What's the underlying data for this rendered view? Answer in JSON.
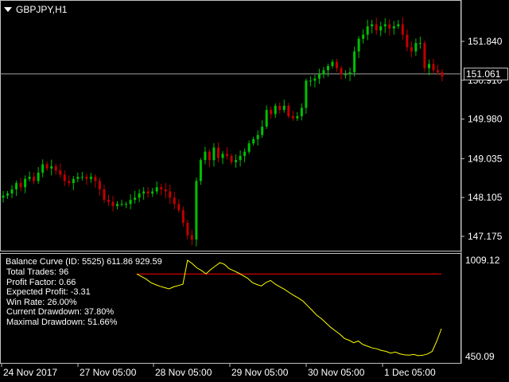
{
  "window": {
    "symbol": "GBPJPY,H1"
  },
  "price_scale": [
    "151.840",
    "150.910",
    "149.980",
    "149.035",
    "148.105",
    "147.175"
  ],
  "current_price": "151.061",
  "indicator": {
    "title": "Balance Curve (ID: 5525) 611.86 929.59",
    "scale": [
      "1009.12",
      "450.09"
    ],
    "stats": [
      "Total Trades: 96",
      "Profit Factor: 0.66",
      "Expected Profit: -3.31",
      "Win Rate: 26.00%",
      "Current Drawdown: 37.80%",
      "Maximal Drawdown: 51.66%"
    ]
  },
  "time_axis": [
    "24 Nov 2017",
    "27 Nov 05:00",
    "28 Nov 05:00",
    "29 Nov 05:00",
    "30 Nov 05:00",
    "1 Dec 05:00"
  ],
  "colors": {
    "background": "#000000",
    "bull_candle": "#00c000",
    "bear_candle": "#c00000",
    "balance_line": "#ffff00",
    "reference_line": "#ff0000",
    "price_line": "#a0a0a0",
    "panel_border": "#c0c0c0"
  },
  "chart_data": [
    {
      "type": "line",
      "title": "",
      "y_ticks": [
        147.175,
        148.105,
        149.035,
        149.98,
        150.91,
        151.84
      ],
      "ylim": [
        146.9,
        152.6
      ],
      "current_price": 151.061,
      "close_series": [
        148.15,
        148.2,
        148.3,
        148.45,
        148.35,
        148.55,
        148.6,
        148.5,
        148.7,
        148.9,
        148.8,
        148.85,
        148.75,
        148.65,
        148.5,
        148.45,
        148.55,
        148.6,
        148.6,
        148.55,
        148.6,
        148.5,
        148.3,
        148.05,
        148.0,
        147.9,
        147.95,
        147.95,
        147.95,
        148.05,
        148.1,
        148.2,
        148.25,
        148.2,
        148.25,
        148.35,
        148.3,
        148.25,
        148.1,
        147.95,
        147.8,
        147.5,
        147.2,
        147.1,
        148.5,
        149.0,
        149.2,
        149.0,
        149.3,
        149.05,
        149.15,
        149.1,
        148.95,
        149.0,
        149.1,
        149.2,
        149.4,
        149.5,
        149.6,
        149.8,
        150.2,
        150.1,
        150.3,
        150.2,
        150.3,
        150.05,
        150.0,
        150.05,
        150.25,
        150.9,
        150.9,
        150.95,
        151.05,
        151.15,
        151.25,
        151.35,
        151.2,
        151.05,
        151.05,
        151.1,
        151.6,
        151.9,
        152.0,
        152.2,
        152.25,
        152.1,
        152.2,
        152.25,
        152.15,
        152.2,
        152.25,
        152.0,
        151.7,
        151.6,
        151.8,
        151.8,
        151.2,
        151.3,
        151.15,
        151.1,
        151.0
      ]
    },
    {
      "type": "line",
      "title": "Balance Curve (ID: 5525) 611.86 929.59",
      "y_ticks": [
        450.09,
        1009.12
      ],
      "ylim": [
        420,
        1040
      ],
      "reference_level": 929.59,
      "values": [
        929.59,
        915,
        900,
        880,
        868,
        858,
        850,
        843,
        855,
        862,
        870,
        1009,
        990,
        965,
        950,
        930,
        955,
        975,
        995,
        985,
        960,
        948,
        935,
        920,
        905,
        880,
        868,
        860,
        880,
        892,
        870,
        855,
        840,
        822,
        805,
        790,
        772,
        745,
        718,
        690,
        670,
        645,
        620,
        600,
        580,
        555,
        545,
        530,
        540,
        520,
        510,
        500,
        495,
        485,
        480,
        470,
        476,
        466,
        460,
        458,
        462,
        455,
        458,
        465,
        480,
        540,
        611.86
      ]
    }
  ]
}
